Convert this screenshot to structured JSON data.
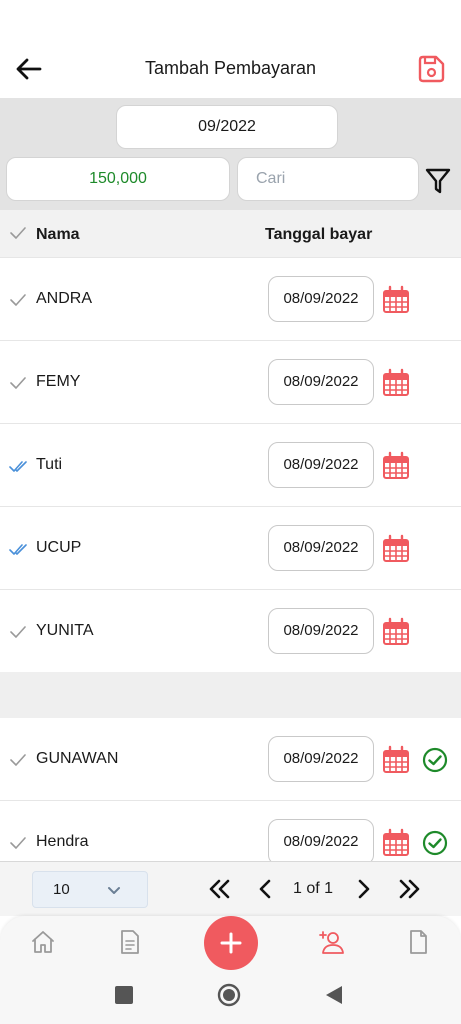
{
  "header": {
    "title": "Tambah Pembayaran"
  },
  "filters": {
    "month": "09/2022",
    "amount": "150,000",
    "search_placeholder": "Cari"
  },
  "table": {
    "columns": {
      "name": "Nama",
      "date": "Tanggal bayar"
    },
    "rows": [
      {
        "name": "ANDRA",
        "date": "08/09/2022",
        "check": "single",
        "done": false
      },
      {
        "name": "FEMY",
        "date": "08/09/2022",
        "check": "single",
        "done": false
      },
      {
        "name": "Tuti",
        "date": "08/09/2022",
        "check": "double",
        "done": false
      },
      {
        "name": "UCUP",
        "date": "08/09/2022",
        "check": "double",
        "done": false
      },
      {
        "name": "YUNITA",
        "date": "08/09/2022",
        "check": "single",
        "done": false
      },
      {
        "name": "GUNAWAN",
        "date": "08/09/2022",
        "check": "single",
        "done": true
      },
      {
        "name": "Hendra",
        "date": "08/09/2022",
        "check": "single",
        "done": true
      }
    ]
  },
  "pagination": {
    "page_size": "10",
    "page_info": "1 of 1"
  },
  "bottom_nav": {
    "active": "add-member",
    "items": [
      "home-icon",
      "document-list-icon",
      "add-icon",
      "add-member-icon",
      "file-icon"
    ]
  },
  "colors": {
    "accent": "#f05a5f",
    "amount": "#1e8a2a",
    "success": "#1e8a2a",
    "double_check": "#4a90d9",
    "single_check": "#9a9a9a"
  }
}
